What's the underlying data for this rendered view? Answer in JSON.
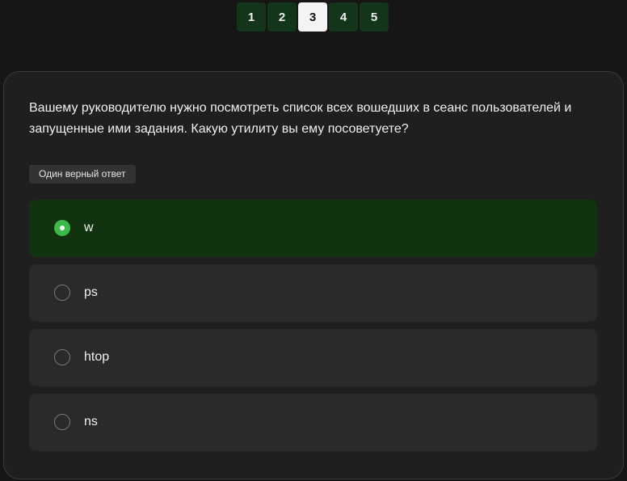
{
  "pager": {
    "pages": [
      "1",
      "2",
      "3",
      "4",
      "5"
    ],
    "current": "3"
  },
  "question": {
    "text": "Вашему руководителю нужно посмотреть список всех вошедших в сеанс пользователей и запущенные ими задания. Какую утилиту вы ему посоветуете?",
    "answer_type": "Один верный ответ"
  },
  "options": [
    {
      "label": "w",
      "selected": true
    },
    {
      "label": "ps",
      "selected": false
    },
    {
      "label": "htop",
      "selected": false
    },
    {
      "label": "ns",
      "selected": false
    }
  ],
  "colors": {
    "background": "#161616",
    "card": "#1f1f1f",
    "pager_inactive": "#13361a",
    "pager_active": "#f4f4f4",
    "option": "#2a2a2a",
    "option_selected": "#12330f",
    "radio_checked": "#3bba4a"
  }
}
